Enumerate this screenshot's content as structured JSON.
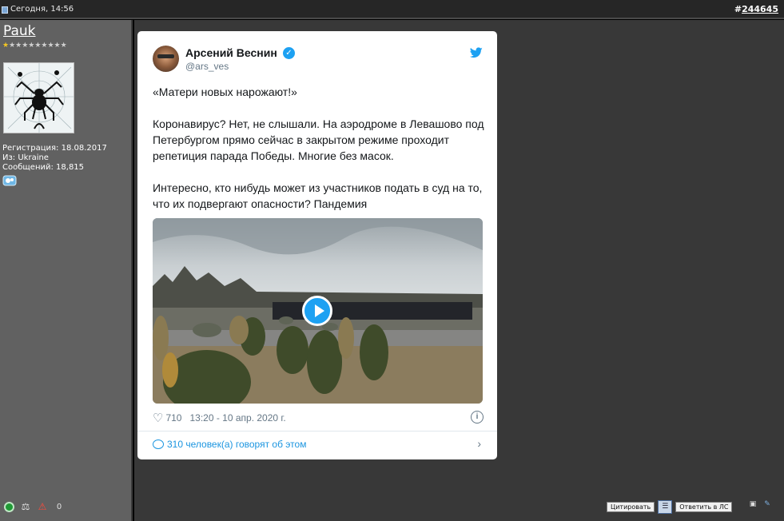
{
  "post": {
    "timestamp": "Сегодня, 14:56",
    "number_prefix": "#",
    "number": "244645"
  },
  "author": {
    "username": "Pauk",
    "stars": "★★★★★★★★★★",
    "registration": "Регистрация: 18.08.2017",
    "from": "Из: Ukraine",
    "messages": "Сообщений: 18,815"
  },
  "tweet": {
    "name": "Арсений Веснин",
    "handle": "@ars_ves",
    "paragraphs": [
      "«Матери новых нарожают!»",
      "Коронавирус? Нет, не слышали. На аэродроме в Левашово под Петербургом прямо сейчас в закрытом режиме проходит репетиция парада Победы. Многие без масок.",
      "Интересно, кто нибудь может из участников подать в суд на то, что их подвергают опасности? Пандемия"
    ],
    "likes": "710",
    "datetime": "13:20 - 10 апр. 2020 г.",
    "discussion": "310 человек(а) говорят об этом",
    "brand_color": "#1da1f2"
  },
  "actions": {
    "quote_label": "Цитировать",
    "reply_pm_label": "Ответить в ЛС"
  }
}
